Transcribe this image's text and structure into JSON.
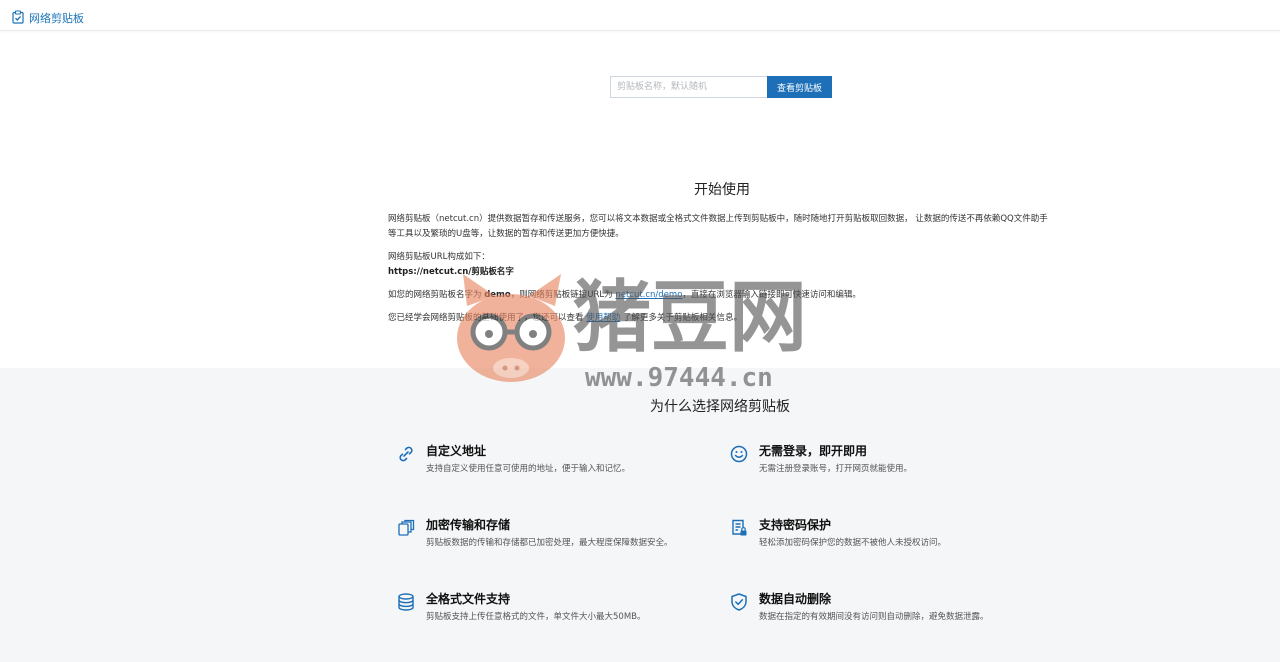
{
  "header": {
    "brand": "网络剪贴板"
  },
  "search": {
    "placeholder": "剪贴板名称，默认随机",
    "button": "查看剪贴板"
  },
  "start": {
    "title": "开始使用",
    "p1": "网络剪贴板（netcut.cn）提供数据暂存和传送服务，您可以将文本数据或全格式文件数据上传到剪贴板中，随时随地打开剪贴板取回数据， 让数据的传送不再依赖QQ文件助手等工具以及繁琐的U盘等，让数据的暂存和传送更加方便快捷。",
    "p2a": "网络剪贴板URL构成如下：",
    "p2b": "https://netcut.cn/剪贴板名字",
    "p3a": "如您的网络剪贴板名字为 ",
    "p3b": "demo",
    "p3c": "，则网络剪贴板链接URL为 ",
    "p3link": "netcut.cn/demo",
    "p3d": "，直接在浏览器输入链接即可快速访问和编辑。",
    "p4a": "您已经学会网络剪贴板的基础使用了，您还可以查看 ",
    "p4link": "使用帮助",
    "p4b": " 了解更多关于剪贴板相关信息。"
  },
  "why": {
    "title": "为什么选择网络剪贴板",
    "features": [
      {
        "icon": "link-icon",
        "title": "自定义地址",
        "desc": "支持自定义使用任意可使用的地址，便于输入和记忆。"
      },
      {
        "icon": "smile-icon",
        "title": "无需登录，即开即用",
        "desc": "无需注册登录账号，打开网页就能使用。"
      },
      {
        "icon": "copy-stack-icon",
        "title": "加密传输和存储",
        "desc": "剪贴板数据的传输和存储都已加密处理，最大程度保障数据安全。"
      },
      {
        "icon": "document-lock-icon",
        "title": "支持密码保护",
        "desc": "轻松添加密码保护您的数据不被他人未授权访问。"
      },
      {
        "icon": "database-icon",
        "title": "全格式文件支持",
        "desc": "剪贴板支持上传任意格式的文件，单文件大小最大50MB。"
      },
      {
        "icon": "shield-check-icon",
        "title": "数据自动删除",
        "desc": "数据在指定的有效期间没有访问则自动删除，避免数据泄露。"
      }
    ]
  },
  "watermark": {
    "brand": "猪豆网",
    "url": "www.97444.cn"
  },
  "colors": {
    "accent": "#1d6fb8",
    "section_bg": "#f4f6f8",
    "watermark": "#d9532c"
  }
}
